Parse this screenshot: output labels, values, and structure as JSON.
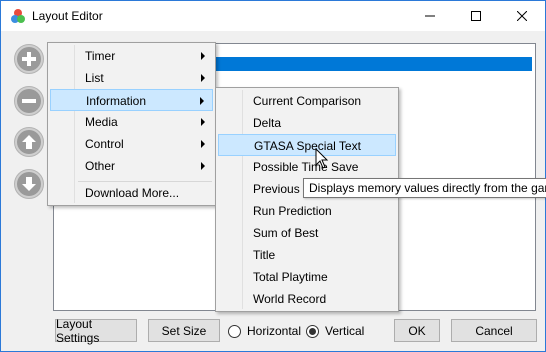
{
  "window": {
    "title": "Layout Editor",
    "minimize_icon": "minimize-icon",
    "maximize_icon": "maximize-icon",
    "close_icon": "close-icon"
  },
  "side_buttons": [
    {
      "icon": "plus-icon"
    },
    {
      "icon": "minus-icon"
    },
    {
      "icon": "arrow-up-icon"
    },
    {
      "icon": "arrow-down-icon"
    }
  ],
  "menu": {
    "items": [
      "Timer",
      "List",
      "Information",
      "Media",
      "Control",
      "Other",
      "Download More..."
    ],
    "highlighted": "Information"
  },
  "submenu": {
    "items": [
      "Current Comparison",
      "Delta",
      "GTASA Special Text",
      "Possible Time Save",
      "Previous Segment",
      "Run Prediction",
      "Sum of Best",
      "Title",
      "Total Playtime",
      "World Record"
    ],
    "highlighted": "GTASA Special Text"
  },
  "tooltip": {
    "text": "Displays memory values directly from the game"
  },
  "footer": {
    "layout_settings": "Layout Settings",
    "set_size": "Set Size",
    "horizontal": "Horizontal",
    "vertical": "Vertical",
    "selected_orientation": "Vertical",
    "ok": "OK",
    "cancel": "Cancel"
  },
  "colors": {
    "selection": "#0078d7",
    "menu_highlight": "#cce8ff",
    "window_border": "#2b79d8"
  }
}
